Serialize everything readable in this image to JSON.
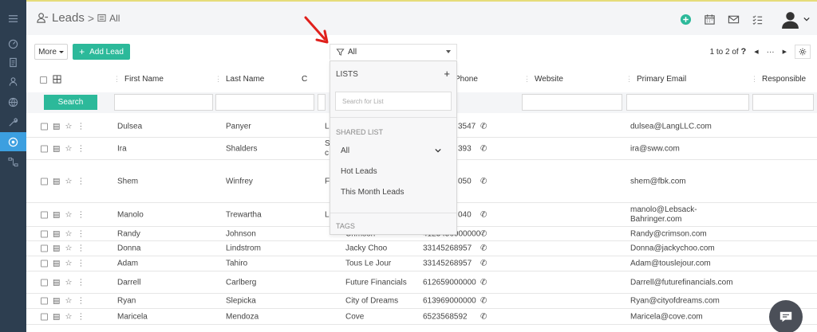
{
  "header": {
    "module_title": "Leads",
    "breadcrumb_sep": ">",
    "view_name": "All",
    "icons": [
      "plus-circle-icon",
      "calendar-icon",
      "envelope-icon",
      "checklist-icon",
      "user-avatar-icon"
    ]
  },
  "sidebar": {
    "items": [
      "menu-icon",
      "dashboard-icon",
      "document-icon",
      "person-icon",
      "globe-icon",
      "wrench-icon",
      "target-icon",
      "workflow-icon"
    ],
    "active": "target-icon"
  },
  "toolbar": {
    "more_label": "More",
    "add_label": "Add Lead",
    "filter_value": "All",
    "pager_text": "1 to 2  of",
    "pager_total": "?",
    "pager_more": "···"
  },
  "table": {
    "columns": {
      "first_name": "First Name",
      "last_name": "Last Name",
      "phone": "Phone",
      "website": "Website",
      "email": "Primary Email",
      "responsible": "Responsible"
    },
    "search_label": "Search",
    "rows": [
      {
        "first": "Dulsea",
        "last": "Panyer",
        "company": "L",
        "phone": "3547",
        "email": "dulsea@LangLLC.com"
      },
      {
        "first": "Ira",
        "last": "Shalders",
        "company": "S",
        "company2": "c",
        "phone": "393",
        "email": "ira@sww.com"
      },
      {
        "first": "Shem",
        "last": "Winfrey",
        "company": "F",
        "phone": "050",
        "email": "shem@fbk.com"
      },
      {
        "first": "Manolo",
        "last": "Trewartha",
        "company": "L",
        "phone": "040",
        "email": "manolo@Lebsack-",
        "email2": "Bahringer.com"
      },
      {
        "first": "Randy",
        "last": "Johnson",
        "company": "Crimson",
        "phone": "4123456000000",
        "email": "Randy@crimson.com"
      },
      {
        "first": "Donna",
        "last": "Lindstrom",
        "company": "Jacky Choo",
        "phone": "33145268957",
        "email": "Donna@jackychoo.com"
      },
      {
        "first": "Adam",
        "last": "Tahiro",
        "company": "Tous Le Jour",
        "phone": "33145268957",
        "email": "Adam@touslejour.com"
      },
      {
        "first": "Darrell",
        "last": "Carlberg",
        "company": "Future Financials",
        "phone": "612659000000",
        "email": "Darrell@futurefinancials.com"
      },
      {
        "first": "Ryan",
        "last": "Slepicka",
        "company": "City of Dreams",
        "phone": "613969000000",
        "email": "Ryan@cityofdreams.com"
      },
      {
        "first": "Maricela",
        "last": "Mendoza",
        "company": "Cove",
        "phone": "6523568592",
        "email": "Maricela@cove.com"
      }
    ]
  },
  "dropdown": {
    "lists_label": "LISTS",
    "add_symbol": "+",
    "search_placeholder": "Search for List",
    "shared_label": "SHARED LIST",
    "items": [
      "All",
      "Hot Leads",
      "This Month Leads"
    ],
    "tags_label": "TAGS"
  },
  "colors": {
    "sidebar": "#2d3e50",
    "accent": "#2cb99a",
    "active_nav": "#3c9fe0",
    "arrow": "#e0201c"
  }
}
